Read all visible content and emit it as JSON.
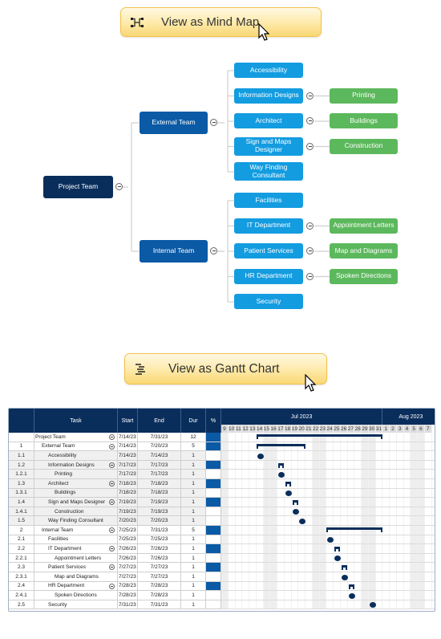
{
  "mind_map_button": {
    "label": "View as Mind Map",
    "icon": "mind-map-icon"
  },
  "gantt_button": {
    "label": "View as Gantt Chart",
    "icon": "gantt-chart-icon"
  },
  "colors": {
    "root": "#0a2e5c",
    "level1": "#0a5aa6",
    "level2": "#139ce0",
    "level3": "#5cb85c",
    "button_border": "#f2c24e",
    "gantt_header": "#0a2e5c",
    "gantt_pct": "#0a5aa6"
  },
  "mind_map": {
    "root": "Project Team",
    "branches": [
      {
        "label": "External Team",
        "children": [
          {
            "label": "Accessibility",
            "children": []
          },
          {
            "label": "Information Designs",
            "children": [
              "Printing"
            ]
          },
          {
            "label": "Architect",
            "children": [
              "Buildings"
            ]
          },
          {
            "label": "Sign and Maps Designer",
            "children": [
              "Construction"
            ]
          },
          {
            "label": "Way Finding Consultant",
            "children": []
          }
        ]
      },
      {
        "label": "Internal Team",
        "children": [
          {
            "label": "Facilities",
            "children": []
          },
          {
            "label": "IT Department",
            "children": [
              "Appointment Letters"
            ]
          },
          {
            "label": "Patient Services",
            "children": [
              "Map and Diagrams"
            ]
          },
          {
            "label": "HR Department",
            "children": [
              "Spoken Directions"
            ]
          },
          {
            "label": "Security",
            "children": []
          }
        ]
      }
    ]
  },
  "gantt": {
    "columns": {
      "wbs": "",
      "task": "Task",
      "start": "Start",
      "end": "End",
      "dur": "Dur",
      "pct": "%"
    },
    "months": [
      "Jul 2023",
      "Aug 2023"
    ],
    "days": [
      "9",
      "10",
      "11",
      "12",
      "13",
      "14",
      "15",
      "16",
      "17",
      "18",
      "19",
      "20",
      "21",
      "22",
      "23",
      "24",
      "25",
      "26",
      "27",
      "28",
      "29",
      "30",
      "31",
      "1",
      "2",
      "3",
      "4",
      "5",
      "6",
      "7"
    ],
    "weekend_days": [
      "9",
      "15",
      "16",
      "22",
      "23",
      "29",
      "30",
      "5",
      "6"
    ],
    "rows": [
      {
        "wbs": "",
        "task": "Project Team",
        "level": 0,
        "collapsible": true,
        "start": "7/14/23",
        "end": "7/31/23",
        "dur": "12",
        "summary": true,
        "s": 14,
        "e": 31
      },
      {
        "wbs": "1",
        "task": "External Team",
        "level": 1,
        "collapsible": true,
        "start": "7/14/23",
        "end": "7/20/23",
        "dur": "5",
        "summary": true,
        "s": 14,
        "e": 20
      },
      {
        "wbs": "1.1",
        "task": "Accessibility",
        "level": 2,
        "collapsible": false,
        "start": "7/14/23",
        "end": "7/14/23",
        "dur": "1",
        "summary": false,
        "s": 14,
        "e": 14
      },
      {
        "wbs": "1.2",
        "task": "Information Designs",
        "level": 2,
        "collapsible": true,
        "start": "7/17/23",
        "end": "7/17/23",
        "dur": "1",
        "summary": true,
        "s": 17,
        "e": 17
      },
      {
        "wbs": "1.2.1",
        "task": "Printing",
        "level": 3,
        "collapsible": false,
        "start": "7/17/23",
        "end": "7/17/23",
        "dur": "1",
        "summary": false,
        "s": 17,
        "e": 17
      },
      {
        "wbs": "1.3",
        "task": "Architect",
        "level": 2,
        "collapsible": true,
        "start": "7/18/23",
        "end": "7/18/23",
        "dur": "1",
        "summary": true,
        "s": 18,
        "e": 18
      },
      {
        "wbs": "1.3.1",
        "task": "Buildings",
        "level": 3,
        "collapsible": false,
        "start": "7/18/23",
        "end": "7/18/23",
        "dur": "1",
        "summary": false,
        "s": 18,
        "e": 18
      },
      {
        "wbs": "1.4",
        "task": "Sign and Maps Designer",
        "level": 2,
        "collapsible": true,
        "start": "7/19/23",
        "end": "7/19/23",
        "dur": "1",
        "summary": true,
        "s": 19,
        "e": 19
      },
      {
        "wbs": "1.4.1",
        "task": "Construction",
        "level": 3,
        "collapsible": false,
        "start": "7/19/23",
        "end": "7/19/23",
        "dur": "1",
        "summary": false,
        "s": 19,
        "e": 19
      },
      {
        "wbs": "1.5",
        "task": "Way Finding Consultant",
        "level": 2,
        "collapsible": false,
        "start": "7/20/23",
        "end": "7/20/23",
        "dur": "1",
        "summary": false,
        "s": 20,
        "e": 20
      },
      {
        "wbs": "2",
        "task": "Internal Team",
        "level": 1,
        "collapsible": true,
        "start": "7/25/23",
        "end": "7/31/23",
        "dur": "5",
        "summary": true,
        "s": 24,
        "e": 31
      },
      {
        "wbs": "2.1",
        "task": "Facilities",
        "level": 2,
        "collapsible": false,
        "start": "7/25/23",
        "end": "7/25/23",
        "dur": "1",
        "summary": false,
        "s": 24,
        "e": 24
      },
      {
        "wbs": "2.2",
        "task": "IT Department",
        "level": 2,
        "collapsible": true,
        "start": "7/26/23",
        "end": "7/26/23",
        "dur": "1",
        "summary": true,
        "s": 25,
        "e": 25
      },
      {
        "wbs": "2.2.1",
        "task": "Appointment Letters",
        "level": 3,
        "collapsible": false,
        "start": "7/26/23",
        "end": "7/26/23",
        "dur": "1",
        "summary": false,
        "s": 25,
        "e": 25
      },
      {
        "wbs": "2.3",
        "task": "Patient Services",
        "level": 2,
        "collapsible": true,
        "start": "7/27/23",
        "end": "7/27/23",
        "dur": "1",
        "summary": true,
        "s": 26,
        "e": 26
      },
      {
        "wbs": "2.3.1",
        "task": "Map and Diagrams",
        "level": 3,
        "collapsible": false,
        "start": "7/27/23",
        "end": "7/27/23",
        "dur": "1",
        "summary": false,
        "s": 26,
        "e": 26
      },
      {
        "wbs": "2.4",
        "task": "HR Department",
        "level": 2,
        "collapsible": true,
        "start": "7/28/23",
        "end": "7/28/23",
        "dur": "1",
        "summary": true,
        "s": 27,
        "e": 27
      },
      {
        "wbs": "2.4.1",
        "task": "Spoken Directions",
        "level": 3,
        "collapsible": false,
        "start": "7/28/23",
        "end": "7/28/23",
        "dur": "1",
        "summary": false,
        "s": 27,
        "e": 27
      },
      {
        "wbs": "2.5",
        "task": "Security",
        "level": 2,
        "collapsible": false,
        "start": "7/31/23",
        "end": "7/31/23",
        "dur": "1",
        "summary": false,
        "s": 30,
        "e": 30
      }
    ]
  }
}
